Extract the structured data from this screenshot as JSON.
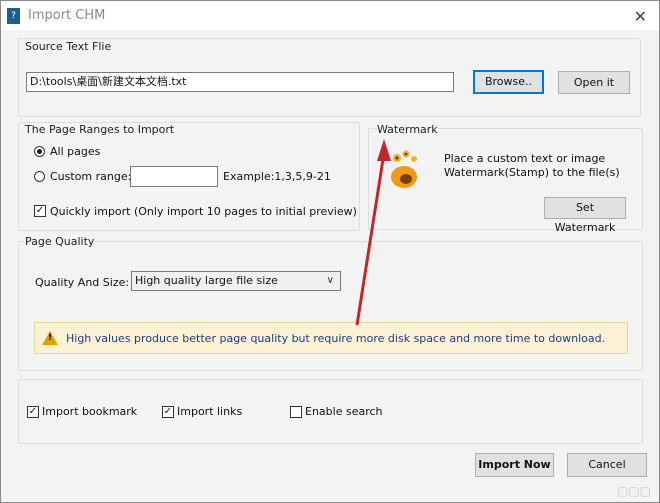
{
  "window": {
    "title": "Import CHM"
  },
  "source": {
    "group_title": "Source Text Flie",
    "path_value": "D:\\tools\\桌面\\新建文本文档.txt",
    "browse_label": "Browse..",
    "open_label": "Open it"
  },
  "page_ranges": {
    "group_title": "The Page Ranges to Import",
    "all_pages_label": "All pages",
    "all_pages_selected": true,
    "custom_range_label": "Custom range:",
    "custom_range_value": "",
    "example_label": "Example:1,3,5,9-21",
    "quick_import_label": "Quickly import (Only import 10 pages to  initial  preview)",
    "quick_import_checked": true
  },
  "watermark": {
    "group_title": "Watermark",
    "description_line1": "Place a custom text or image",
    "description_line2": "Watermark(Stamp) to the file(s)",
    "set_button_label": "Set Watermark"
  },
  "quality": {
    "group_title": "Page Quality",
    "size_label": "Quality And Size:",
    "selected_value": "High quality large file size",
    "warning_text": "High values produce better page quality but require more disk space and more time to download."
  },
  "options": {
    "import_bookmark_label": "Import bookmark",
    "import_bookmark_checked": true,
    "import_links_label": "Import links",
    "import_links_checked": true,
    "enable_search_label": "Enable search",
    "enable_search_checked": false
  },
  "footer": {
    "import_now_label": "Import Now",
    "cancel_label": "Cancel"
  },
  "colors": {
    "annotation_arrow": "#c0262b",
    "accent_border": "#0078d7",
    "warning_bg": "#fdf2d6"
  }
}
